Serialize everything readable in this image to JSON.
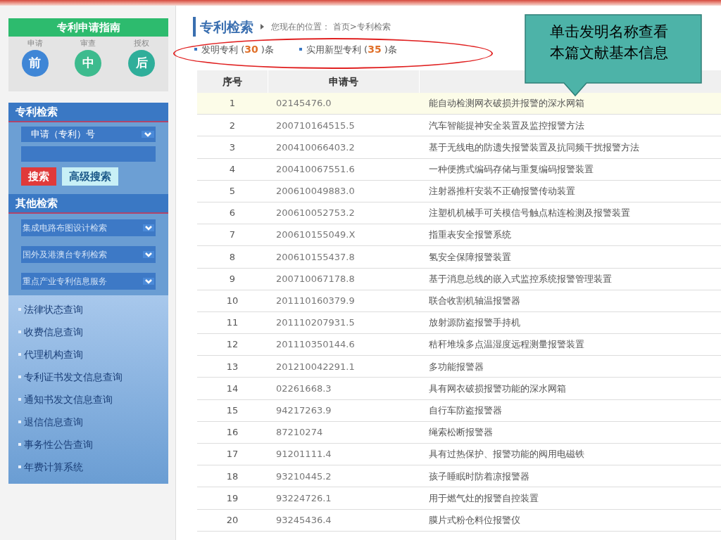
{
  "guide": {
    "title": "专利申请指南",
    "steps": [
      {
        "label": "申请",
        "mark": "前",
        "color": "#3f86d6"
      },
      {
        "label": "审查",
        "mark": "中",
        "color": "#3dbb8e"
      },
      {
        "label": "授权",
        "mark": "后",
        "color": "#2fae9a"
      }
    ]
  },
  "search": {
    "title": "专利检索",
    "field_type": "申请（专利）号",
    "buttons": [
      {
        "label": "搜索",
        "kind": "primary"
      },
      {
        "label": "高级搜索",
        "kind": "secondary"
      }
    ]
  },
  "other_search": {
    "title": "其他检索",
    "selects": [
      "集成电路布图设计检索",
      "国外及港澳台专利检索",
      "重点产业专利信息服务"
    ]
  },
  "links": [
    "法律状态查询",
    "收费信息查询",
    "代理机构查询",
    "专利证书发文信息查询",
    "通知书发文信息查询",
    "退信信息查询",
    "事务性公告查询",
    "年费计算系统"
  ],
  "page": {
    "title": "专利检索",
    "breadcrumb_label": "您现在的位置：",
    "breadcrumb": "首页>专利检索"
  },
  "tabs": [
    {
      "label": "发明专利",
      "open": "(",
      "count": "30",
      "close": ")条"
    },
    {
      "label": "实用新型专利",
      "open": "(",
      "count": "35",
      "close": ")条"
    }
  ],
  "table": {
    "columns": [
      "序号",
      "申请号"
    ],
    "rows": [
      {
        "no": "1",
        "app": "02145476.0",
        "name": "能自动检测网衣破损并报警的深水网箱",
        "selected": true
      },
      {
        "no": "2",
        "app": "200710164515.5",
        "name": "汽车智能提神安全装置及监控报警方法",
        "selected": false
      },
      {
        "no": "3",
        "app": "200410066403.2",
        "name": "基于无线电的防遗失报警装置及抗同频干扰报警方法",
        "selected": false
      },
      {
        "no": "4",
        "app": "200410067551.6",
        "name": "一种便携式编码存储与重复编码报警装置",
        "selected": false
      },
      {
        "no": "5",
        "app": "200610049883.0",
        "name": "注射器推杆安装不正确报警传动装置",
        "selected": false
      },
      {
        "no": "6",
        "app": "200610052753.2",
        "name": "注塑机机械手可关模信号触点粘连检测及报警装置",
        "selected": false
      },
      {
        "no": "7",
        "app": "200610155049.X",
        "name": "指重表安全报警系统",
        "selected": false
      },
      {
        "no": "8",
        "app": "200610155437.8",
        "name": "氢安全保障报警装置",
        "selected": false
      },
      {
        "no": "9",
        "app": "200710067178.8",
        "name": "基于消息总线的嵌入式监控系统报警管理装置",
        "selected": false
      },
      {
        "no": "10",
        "app": "201110160379.9",
        "name": "联合收割机轴温报警器",
        "selected": false
      },
      {
        "no": "11",
        "app": "201110207931.5",
        "name": "放射源防盗报警手持机",
        "selected": false
      },
      {
        "no": "12",
        "app": "201110350144.6",
        "name": "秸秆堆垛多点温湿度远程测量报警装置",
        "selected": false
      },
      {
        "no": "13",
        "app": "201210042291.1",
        "name": "多功能报警器",
        "selected": false
      },
      {
        "no": "14",
        "app": "02261668.3",
        "name": "具有网衣破损报警功能的深水网箱",
        "selected": false
      },
      {
        "no": "15",
        "app": "94217263.9",
        "name": "自行车防盗报警器",
        "selected": false
      },
      {
        "no": "16",
        "app": "87210274",
        "name": "绳索松断报警器",
        "selected": false
      },
      {
        "no": "17",
        "app": "91201111.4",
        "name": "具有过热保护、报警功能的阀用电磁铁",
        "selected": false
      },
      {
        "no": "18",
        "app": "93210445.2",
        "name": "孩子睡眠时防着凉报警器",
        "selected": false
      },
      {
        "no": "19",
        "app": "93224726.1",
        "name": "用于燃气灶的报警自控装置",
        "selected": false
      },
      {
        "no": "20",
        "app": "93245436.4",
        "name": "膜片式粉仓料位报警仪",
        "selected": false
      }
    ]
  },
  "callout": {
    "text": "单击发明名称查看本篇文献基本信息"
  }
}
